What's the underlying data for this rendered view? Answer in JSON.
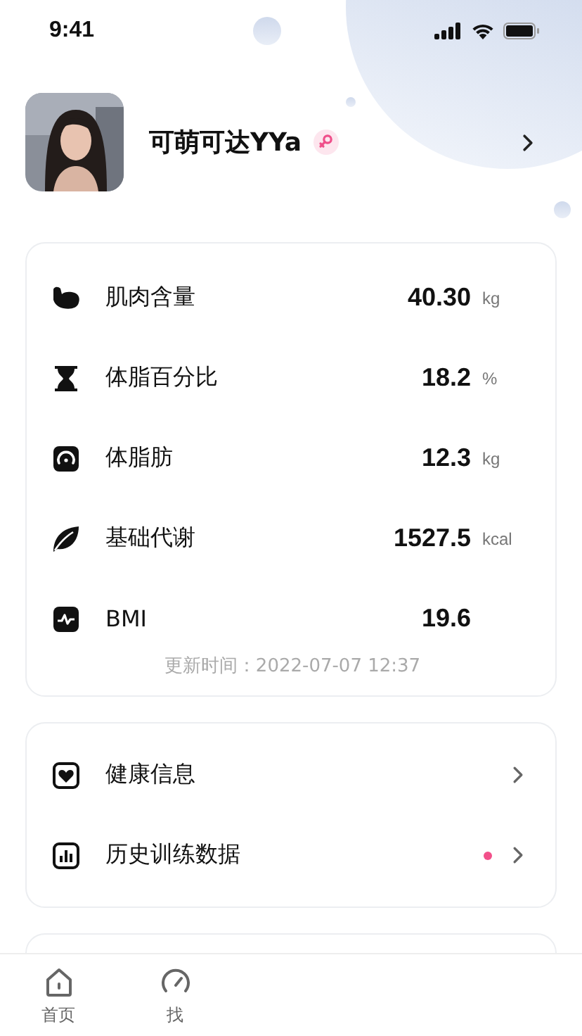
{
  "status_bar": {
    "time": "9:41"
  },
  "profile": {
    "name": "可萌可达YYa"
  },
  "metrics": [
    {
      "label": "肌肉含量",
      "value": "40.30",
      "unit": "kg"
    },
    {
      "label": "体脂百分比",
      "value": "18.2",
      "unit": "%"
    },
    {
      "label": "体脂肪",
      "value": "12.3",
      "unit": "kg"
    },
    {
      "label": "基础代谢",
      "value": "1527.5",
      "unit": "kcal"
    },
    {
      "label": "BMI",
      "value": "19.6"
    }
  ],
  "updated": "更新时间：2022-07-07  12:37",
  "menu": [
    {
      "label": "健康信息",
      "badge": false
    },
    {
      "label": "历史训练数据",
      "badge": true
    }
  ],
  "tab_bar": [
    {
      "label": "首页",
      "selected": false
    },
    {
      "label": "找",
      "selected": false
    }
  ]
}
